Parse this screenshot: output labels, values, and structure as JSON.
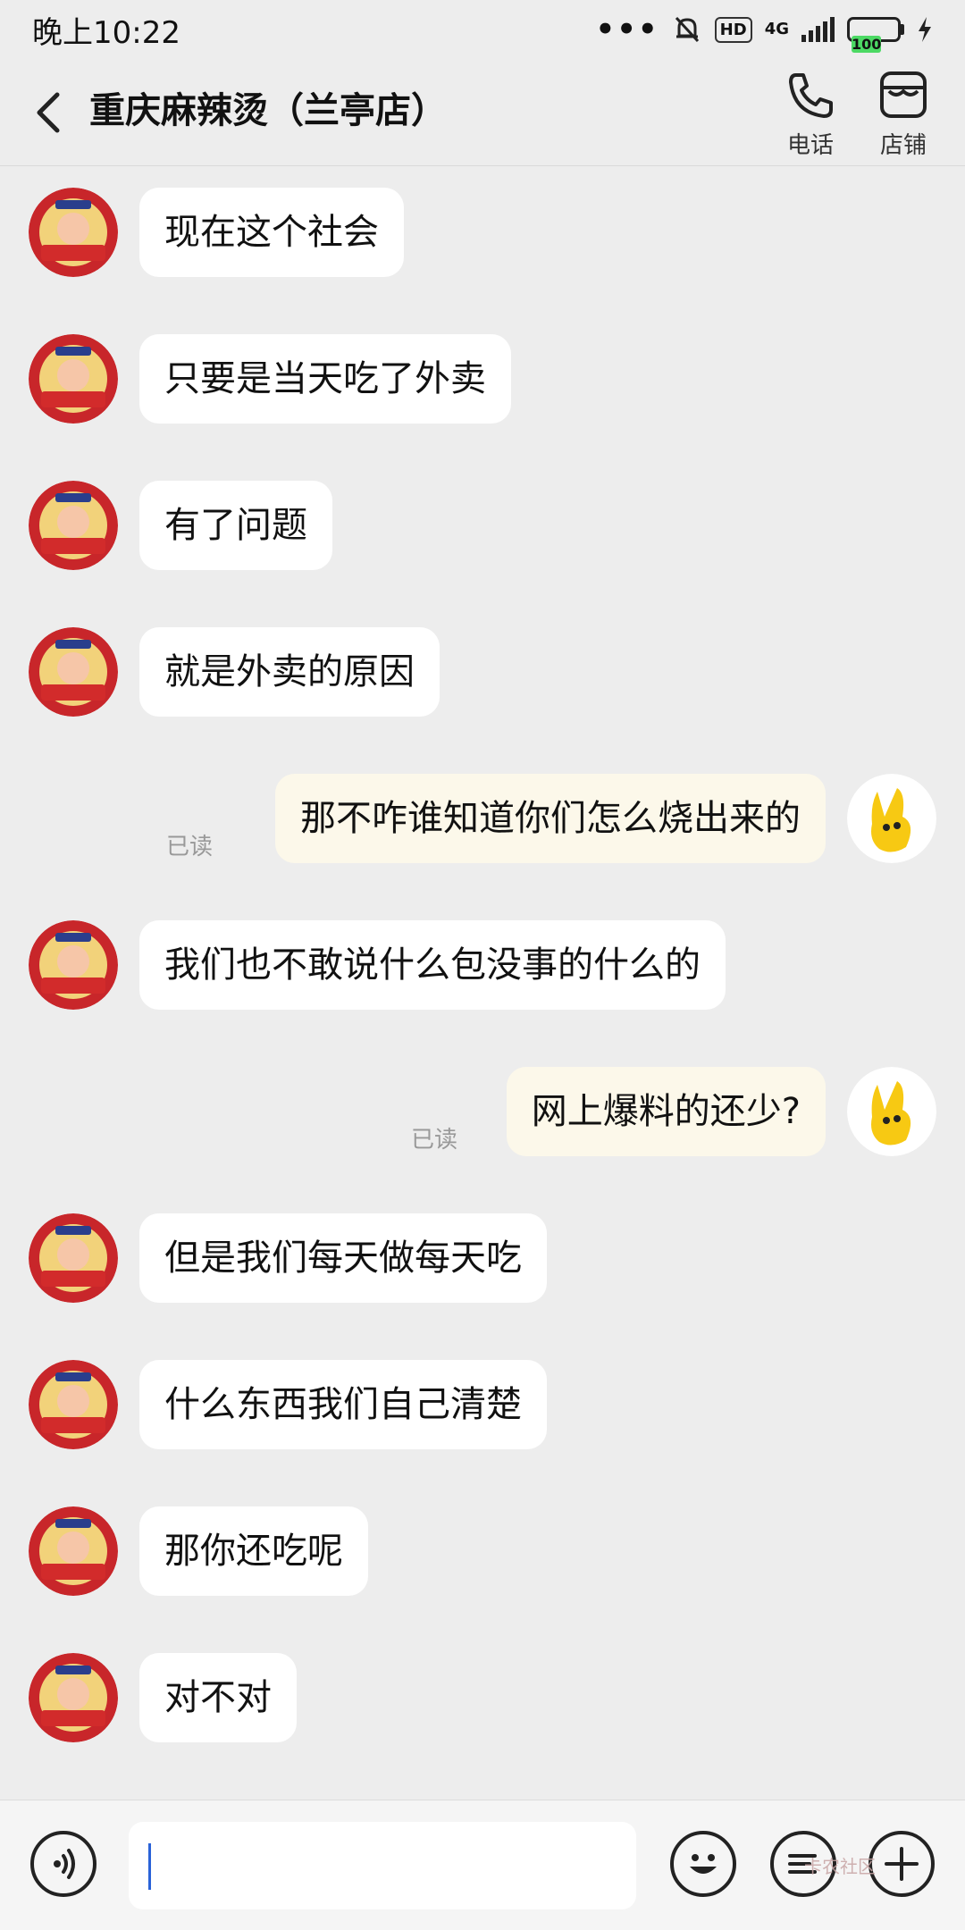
{
  "status": {
    "time": "晚上10:22",
    "hd": "HD",
    "network": "4G",
    "battery": "100"
  },
  "header": {
    "title": "重庆麻辣烫（兰亭店）",
    "phone_label": "电话",
    "shop_label": "店铺"
  },
  "messages": [
    {
      "side": "in",
      "text": "现在这个社会"
    },
    {
      "side": "in",
      "text": "只要是当天吃了外卖"
    },
    {
      "side": "in",
      "text": "有了问题"
    },
    {
      "side": "in",
      "text": "就是外卖的原因"
    },
    {
      "side": "out",
      "text": "那不咋谁知道你们怎么烧出来的",
      "read": "已读"
    },
    {
      "side": "in",
      "text": "我们也不敢说什么包没事的什么的"
    },
    {
      "side": "out",
      "text": "网上爆料的还少?",
      "read": "已读"
    },
    {
      "side": "in",
      "text": "但是我们每天做每天吃"
    },
    {
      "side": "in",
      "text": "什么东西我们自己清楚"
    },
    {
      "side": "in",
      "text": "那你还吃呢"
    },
    {
      "side": "in",
      "text": "对不对"
    }
  ],
  "input": {
    "value": "",
    "watermark": "卡农社区"
  },
  "colors": {
    "background": "#ededed",
    "incoming_bubble": "#ffffff",
    "outgoing_bubble": "#fcf8ea",
    "avatar_me": "#f7c913",
    "avatar_shop": "#c8262a"
  }
}
